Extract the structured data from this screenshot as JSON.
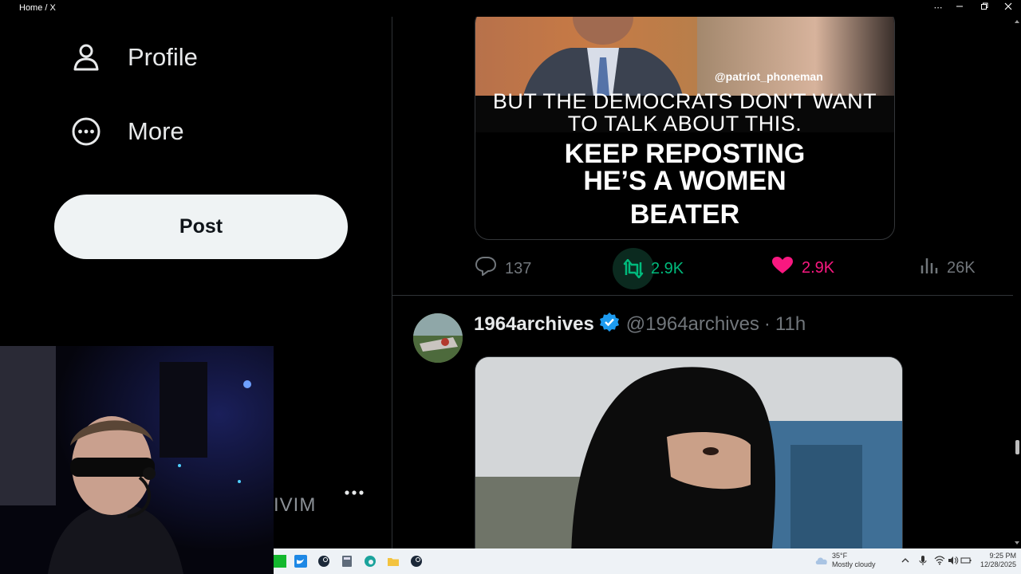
{
  "window": {
    "title": "Home / X",
    "controls": [
      "more-icon",
      "minimize-icon",
      "restore-icon",
      "close-icon"
    ]
  },
  "sidebar": {
    "items": [
      {
        "label": "Profile",
        "icon": "person-icon"
      },
      {
        "label": "More",
        "icon": "more-circle-icon"
      }
    ],
    "post_button": "Post",
    "account_fragment": "IVIM",
    "account_more_icon": "ellipsis-icon"
  },
  "timeline": {
    "prev_tweet": {
      "media": {
        "watermark": "@patriot_phoneman",
        "caption_line1": "BUT THE DEMOCRATS DON'T WANT",
        "caption_line2": "TO TALK ABOUT THIS.",
        "caption_big1": "KEEP REPOSTING",
        "caption_big2": "HE’S A WOMEN",
        "caption_big3": "BEATER"
      },
      "actions": {
        "replies": "137",
        "reposts": "2.9K",
        "likes": "2.9K",
        "views": "26K"
      }
    },
    "tweet": {
      "display_name": "1964archives",
      "handle": "@1964archives",
      "separator": "·",
      "time": "11h",
      "verified": true
    }
  },
  "taskbar": {
    "weather_temp": "35°F",
    "weather_desc": "Mostly cloudy",
    "time": "9:25 PM",
    "date": "12/28/2025"
  },
  "colors": {
    "background": "#000000",
    "text": "#e7e9ea",
    "muted": "#71767b",
    "repost_green": "#00ba7c",
    "like_pink": "#f91880",
    "verified_blue": "#1d9bf0",
    "post_button_bg": "#eff3f4"
  }
}
